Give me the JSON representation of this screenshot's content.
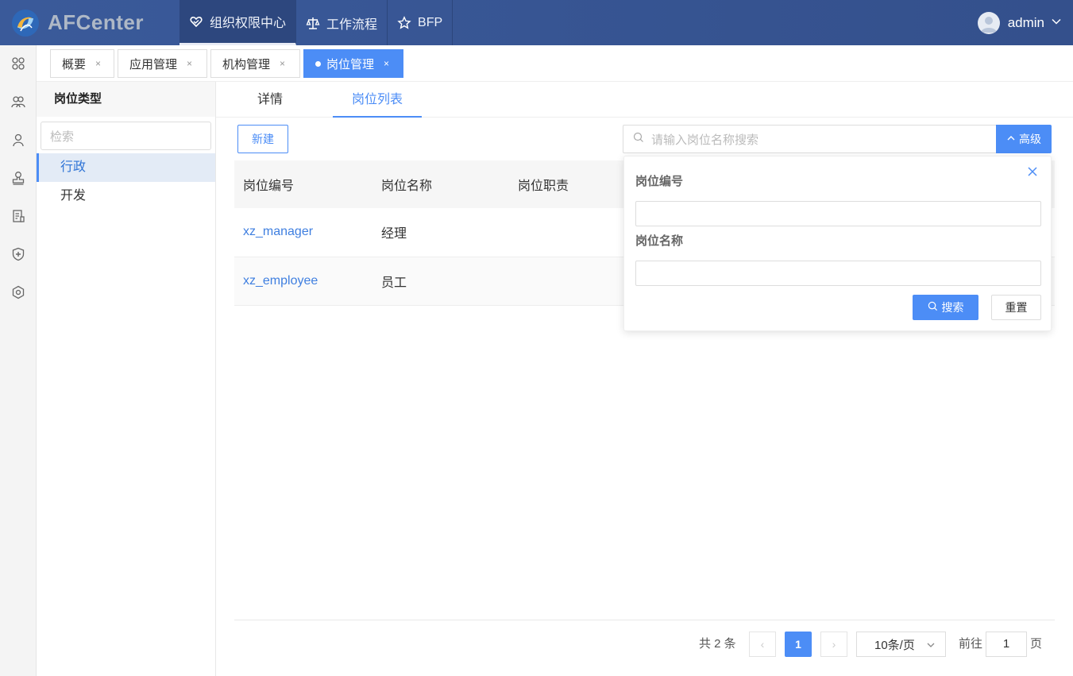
{
  "app": {
    "name": "AFCenter"
  },
  "topnav": [
    {
      "label": "组织权限中心",
      "icon": "heart-shield-icon",
      "active": true
    },
    {
      "label": "工作流程",
      "icon": "scale-icon",
      "active": false
    },
    {
      "label": "BFP",
      "icon": "star-icon",
      "active": false
    }
  ],
  "user": {
    "name": "admin"
  },
  "sidebar_icons": [
    "apps-icon",
    "users-group-icon",
    "user-icon",
    "stamp-icon",
    "form-icon",
    "shield-plus-icon",
    "settings-hex-icon"
  ],
  "tabs": [
    {
      "label": "概要",
      "close": "×",
      "active": false
    },
    {
      "label": "应用管理",
      "close": "×",
      "active": false
    },
    {
      "label": "机构管理",
      "close": "×",
      "active": false
    },
    {
      "label": "岗位管理",
      "close": "×",
      "active": true
    }
  ],
  "left": {
    "title": "岗位类型",
    "search_placeholder": "检索",
    "items": [
      {
        "label": "行政",
        "active": true
      },
      {
        "label": "开发",
        "active": false
      }
    ]
  },
  "subtabs": [
    {
      "label": "详情",
      "active": false
    },
    {
      "label": "岗位列表",
      "active": true
    }
  ],
  "toolbar": {
    "new_label": "新建",
    "search_placeholder": "请输入岗位名称搜索",
    "advanced_label": "高级"
  },
  "table": {
    "columns": [
      "岗位编号",
      "岗位名称",
      "岗位职责"
    ],
    "rows": [
      {
        "code": "xz_manager",
        "name": "经理",
        "duty": ""
      },
      {
        "code": "xz_employee",
        "name": "员工",
        "duty": ""
      }
    ]
  },
  "pagination": {
    "total_text": "共 2 条",
    "prev": "‹",
    "next": "›",
    "current_page": "1",
    "page_size": "10条/页",
    "goto_label": "前往",
    "goto_value": "1",
    "page_unit": "页"
  },
  "advanced": {
    "field1_label": "岗位编号",
    "field2_label": "岗位名称",
    "search_label": "搜索",
    "reset_label": "重置"
  },
  "colors": {
    "primary": "#4c8df6",
    "header": "#3a5a9a"
  }
}
